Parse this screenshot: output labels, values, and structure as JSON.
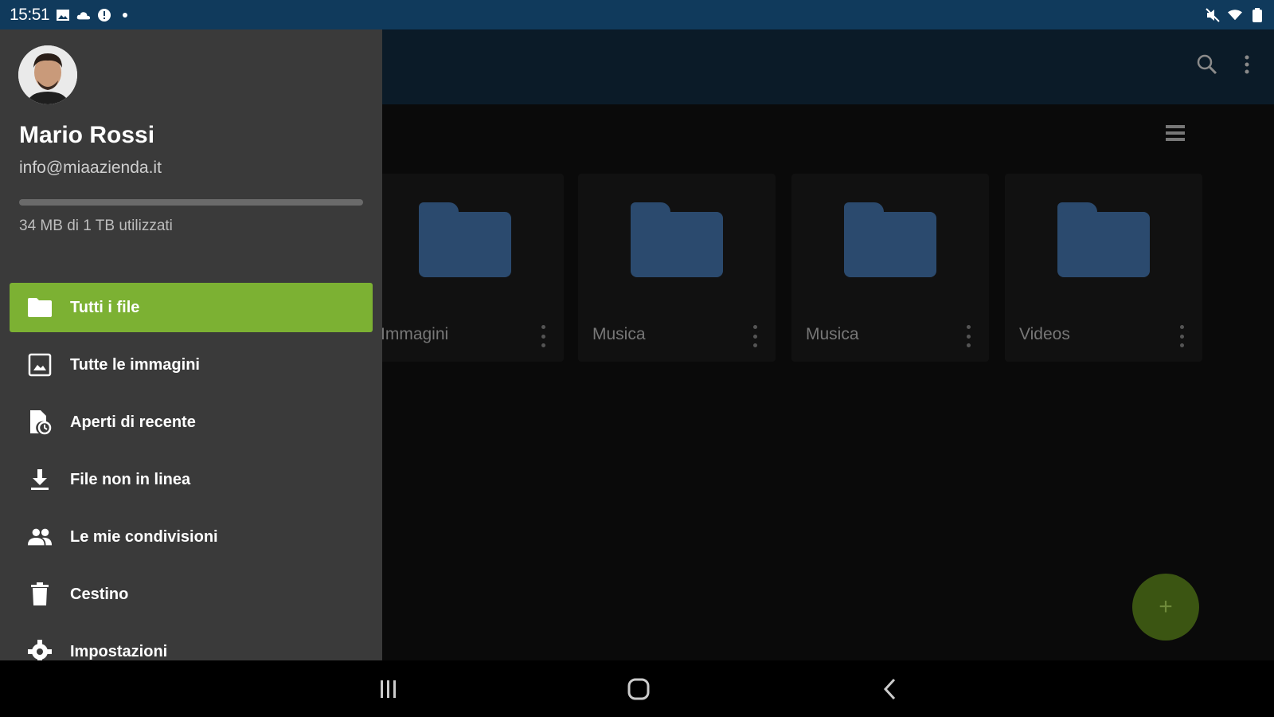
{
  "status_bar": {
    "time": "15:51",
    "left_icons": [
      "gallery-icon",
      "cloud-icon",
      "alert-icon",
      "dot-icon"
    ],
    "right_icons": [
      "mute-icon",
      "wifi-icon",
      "battery-icon"
    ]
  },
  "drawer": {
    "user": {
      "name": "Mario Rossi",
      "email": "info@miaazienda.it"
    },
    "storage": {
      "text": "34 MB di 1 TB utilizzati",
      "used_fraction": 0.0
    },
    "menu": [
      {
        "label": "Tutti i file",
        "icon": "folder-icon",
        "active": true
      },
      {
        "label": "Tutte le immagini",
        "icon": "image-icon",
        "active": false
      },
      {
        "label": "Aperti di recente",
        "icon": "recent-file-icon",
        "active": false
      },
      {
        "label": "File non in linea",
        "icon": "download-icon",
        "active": false
      },
      {
        "label": "Le mie condivisioni",
        "icon": "people-icon",
        "active": false
      },
      {
        "label": "Cestino",
        "icon": "trash-icon",
        "active": false
      },
      {
        "label": "Impostazioni",
        "icon": "gear-icon",
        "active": false
      }
    ]
  },
  "main": {
    "folders": [
      {
        "name": "Immagini"
      },
      {
        "name": "Musica"
      },
      {
        "name": "Musica"
      },
      {
        "name": "Videos"
      }
    ],
    "fab_label": "+"
  },
  "colors": {
    "accent": "#7cb133",
    "status_bar": "#103a5c",
    "drawer": "#3a3a3a",
    "folder": "#2b4a6e"
  }
}
